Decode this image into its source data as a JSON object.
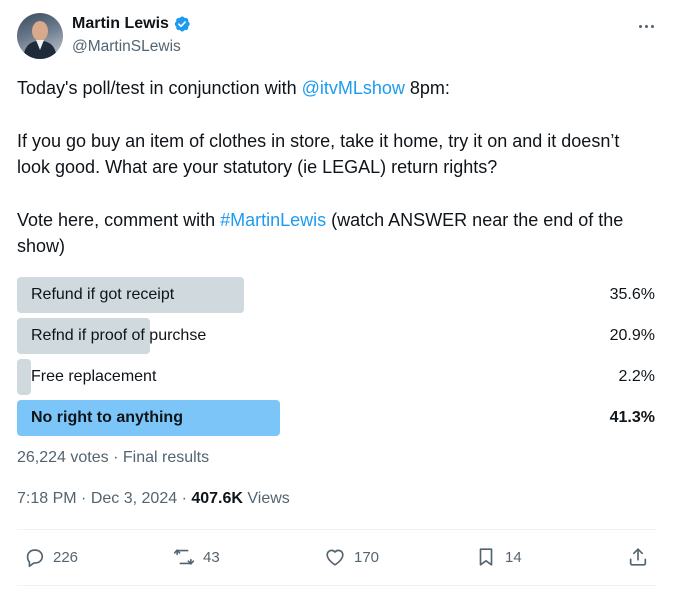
{
  "author": {
    "name": "Martin Lewis",
    "handle": "@MartinSLewis",
    "verified": true
  },
  "tweet": {
    "line1_prefix": "Today's poll/test in conjunction with ",
    "line1_mention": "@itvMLshow",
    "line1_suffix": " 8pm:",
    "paragraph2": "If you go buy an item of clothes in store, take it home, try it on and it doesn’t look good. What are your statutory (ie LEGAL) return rights?",
    "para3_prefix": "Vote here, comment with ",
    "para3_hashtag": "#MartinLewis",
    "para3_suffix": " (watch ANSWER near the end of the show)"
  },
  "poll": {
    "options": [
      {
        "label": "Refund if got receipt",
        "percent_text": "35.6%",
        "percent": 35.6,
        "winner": false
      },
      {
        "label": "Refnd if proof of purchse",
        "percent_text": "20.9%",
        "percent": 20.9,
        "winner": false
      },
      {
        "label": "Free replacement",
        "percent_text": "2.2%",
        "percent": 2.2,
        "winner": false
      },
      {
        "label": "No right to anything",
        "percent_text": "41.3%",
        "percent": 41.3,
        "winner": true
      }
    ],
    "votes": "26,224 votes",
    "status": "Final results",
    "colors": {
      "bar": "#cfd9de",
      "winner_bar": "#7cc5f8"
    }
  },
  "meta": {
    "time": "7:18 PM",
    "date": "Dec 3, 2024",
    "views_count": "407.6K",
    "views_label": "Views"
  },
  "actions": {
    "replies": "226",
    "reposts": "43",
    "likes": "170",
    "bookmarks": "14"
  },
  "colors": {
    "link": "#1d9bf0",
    "secondary_text": "#536471",
    "verified_badge": "#1d9bf0"
  }
}
